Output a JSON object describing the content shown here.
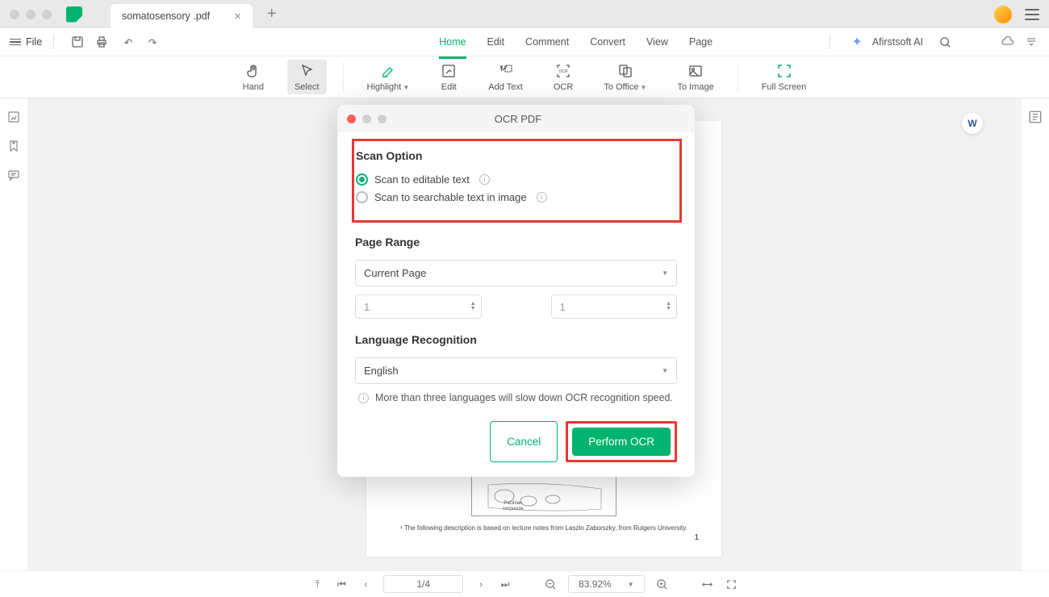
{
  "tab": {
    "title": "somatosensory .pdf"
  },
  "file_label": "File",
  "menu_tabs": [
    "Home",
    "Edit",
    "Comment",
    "Convert",
    "View",
    "Page"
  ],
  "active_menu_tab": 0,
  "ai_label": "Afirstsoft AI",
  "ribbon": [
    {
      "label": "Hand"
    },
    {
      "label": "Select",
      "active": true
    },
    {
      "label": "Highlight",
      "dropdown": true
    },
    {
      "label": "Edit"
    },
    {
      "label": "Add Text"
    },
    {
      "label": "OCR"
    },
    {
      "label": "To Office",
      "dropdown": true
    },
    {
      "label": "To Image"
    },
    {
      "label": "Full Screen"
    }
  ],
  "modal": {
    "title": "OCR PDF",
    "scan_option_title": "Scan Option",
    "scan_options": [
      {
        "label": "Scan to editable text",
        "checked": true
      },
      {
        "label": "Scan to searchable text in image",
        "checked": false
      }
    ],
    "page_range_title": "Page Range",
    "page_range_selected": "Current Page",
    "range_from": "1",
    "range_to": "1",
    "language_title": "Language Recognition",
    "language_selected": "English",
    "language_note": "More than three languages will slow down OCR recognition speed.",
    "cancel_label": "Cancel",
    "perform_label": "Perform OCR"
  },
  "document": {
    "footnote": "¹ The following description is based on lecture notes from Laszlo Zaborszky, from Rutgers University.",
    "pagenum": "1",
    "illustration_label1": "Pacinian",
    "illustration_label2": "corpuscle"
  },
  "status": {
    "page": "1/4",
    "zoom": "83.92%"
  }
}
